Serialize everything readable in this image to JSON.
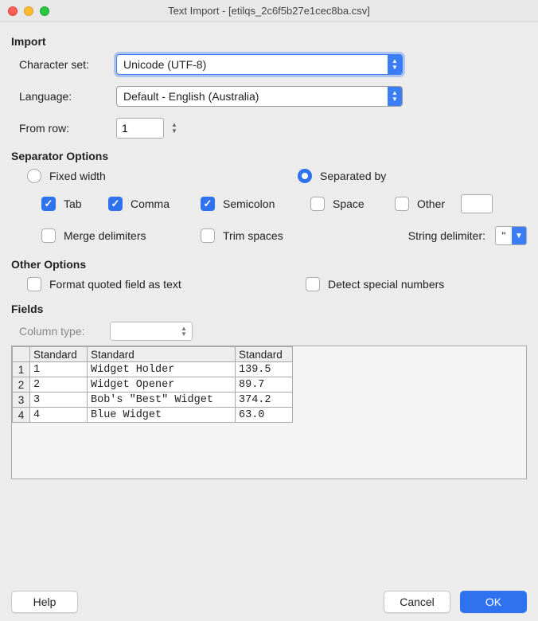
{
  "window": {
    "title": "Text Import - [etilqs_2c6f5b27e1cec8ba.csv]"
  },
  "import": {
    "heading": "Import",
    "charset_label": "Character set:",
    "charset_value": "Unicode (UTF-8)",
    "language_label": "Language:",
    "language_value": "Default - English (Australia)",
    "from_row_label": "From row:",
    "from_row_value": "1"
  },
  "separator": {
    "heading": "Separator Options",
    "fixed_width": "Fixed width",
    "separated_by": "Separated by",
    "tab": "Tab",
    "comma": "Comma",
    "semicolon": "Semicolon",
    "space": "Space",
    "other": "Other",
    "merge": "Merge delimiters",
    "trim": "Trim spaces",
    "string_delim_label": "String delimiter:",
    "string_delim_value": "\""
  },
  "other": {
    "heading": "Other Options",
    "quoted_text": "Format quoted field as text",
    "detect_numbers": "Detect special numbers"
  },
  "fields": {
    "heading": "Fields",
    "column_type_label": "Column type:",
    "headers": [
      "Standard",
      "Standard",
      "Standard"
    ],
    "rows": [
      {
        "n": "1",
        "c": [
          "1",
          "Widget Holder",
          "139.5"
        ]
      },
      {
        "n": "2",
        "c": [
          "2",
          "Widget Opener",
          "89.7"
        ]
      },
      {
        "n": "3",
        "c": [
          "3",
          "Bob's \"Best\" Widget",
          "374.2"
        ]
      },
      {
        "n": "4",
        "c": [
          "4",
          "Blue Widget",
          "63.0"
        ]
      }
    ]
  },
  "buttons": {
    "help": "Help",
    "cancel": "Cancel",
    "ok": "OK"
  }
}
